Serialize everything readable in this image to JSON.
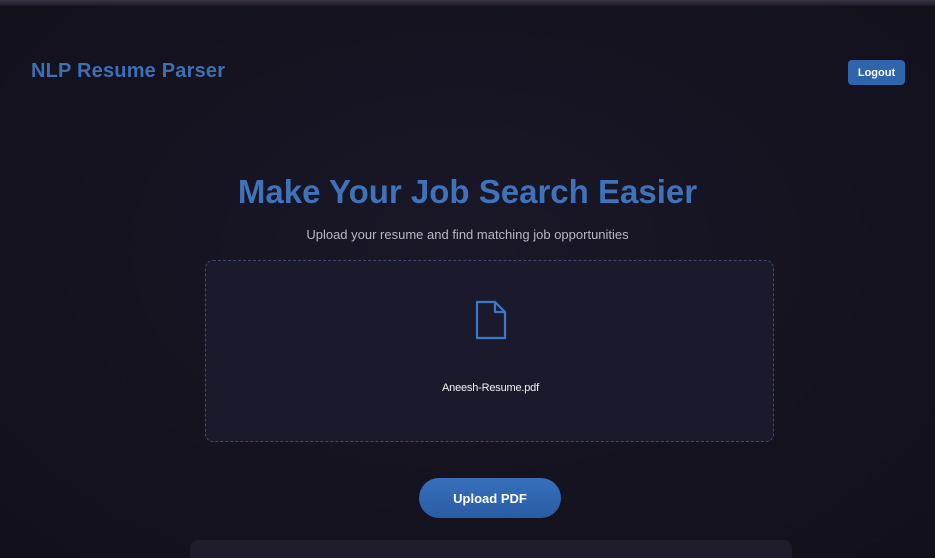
{
  "header": {
    "brand": "NLP Resume Parser",
    "logout_label": "Logout"
  },
  "hero": {
    "title": "Make Your Job Search Easier",
    "subtitle": "Upload your resume and find matching job opportunities"
  },
  "upload": {
    "file_icon": "file-icon",
    "file_name": "Aneesh-Resume.pdf",
    "button_label": "Upload PDF"
  },
  "colors": {
    "background": "#15131f",
    "accent": "#3f72b8",
    "dropzone_bg": "#1b1a2c",
    "dropzone_border": "#3c4a6e"
  }
}
